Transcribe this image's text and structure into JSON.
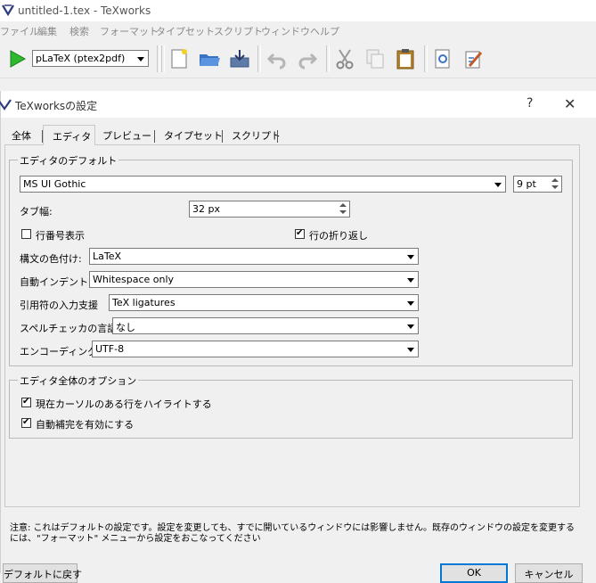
{
  "window": {
    "title": "untitled-1.tex - TeXworks"
  },
  "menu": [
    "ファイル",
    "編集",
    "検索",
    "フォーマット",
    "タイプセット",
    "スクリプト",
    "ウィンドウ",
    "ヘルプ"
  ],
  "toolbar": {
    "engine": "pLaTeX (ptex2pdf)"
  },
  "dialog": {
    "title": "TeXworksの設定",
    "help": "?",
    "close": "✕",
    "tabs": [
      "全体",
      "エディタ",
      "プレビュー",
      "タイプセット",
      "スクリプト"
    ],
    "active_tab": "エディタ",
    "defaults_group": {
      "title": "エディタのデフォルト",
      "font": "MS UI Gothic",
      "font_size": "9 pt",
      "tab_width_label": "タブ幅:",
      "tab_width": "32 px",
      "line_numbers_label": "行番号表示",
      "line_numbers_checked": false,
      "wrap_label": "行の折り返し",
      "wrap_checked": true,
      "syntax_label": "構文の色付け:",
      "syntax_value": "LaTeX",
      "indent_label": "自動インデント:",
      "indent_value": "Whitespace only",
      "quote_label": "引用符の入力支援",
      "quote_value": "TeX ligatures",
      "spell_label": "スペルチェッカの言語:",
      "spell_value": "なし",
      "encoding_label": "エンコーディング:",
      "encoding_value": "UTF-8"
    },
    "global_group": {
      "title": "エディタ全体のオプション",
      "highlight_label": "現在カーソルのある行をハイライトする",
      "highlight_checked": true,
      "autocomplete_label": "自動補完を有効にする",
      "autocomplete_checked": true
    },
    "note_line1": "注意: これはデフォルトの設定です。設定を変更しても、すでに開いているウィンドウには影響しません。既存のウィンドウの設定を変更する",
    "note_line2": "には、\"フォーマット\" メニューから設定をおこなってください",
    "buttons": {
      "restore": "デフォルトに戻す",
      "ok": "OK",
      "cancel": "キャンセル"
    }
  }
}
